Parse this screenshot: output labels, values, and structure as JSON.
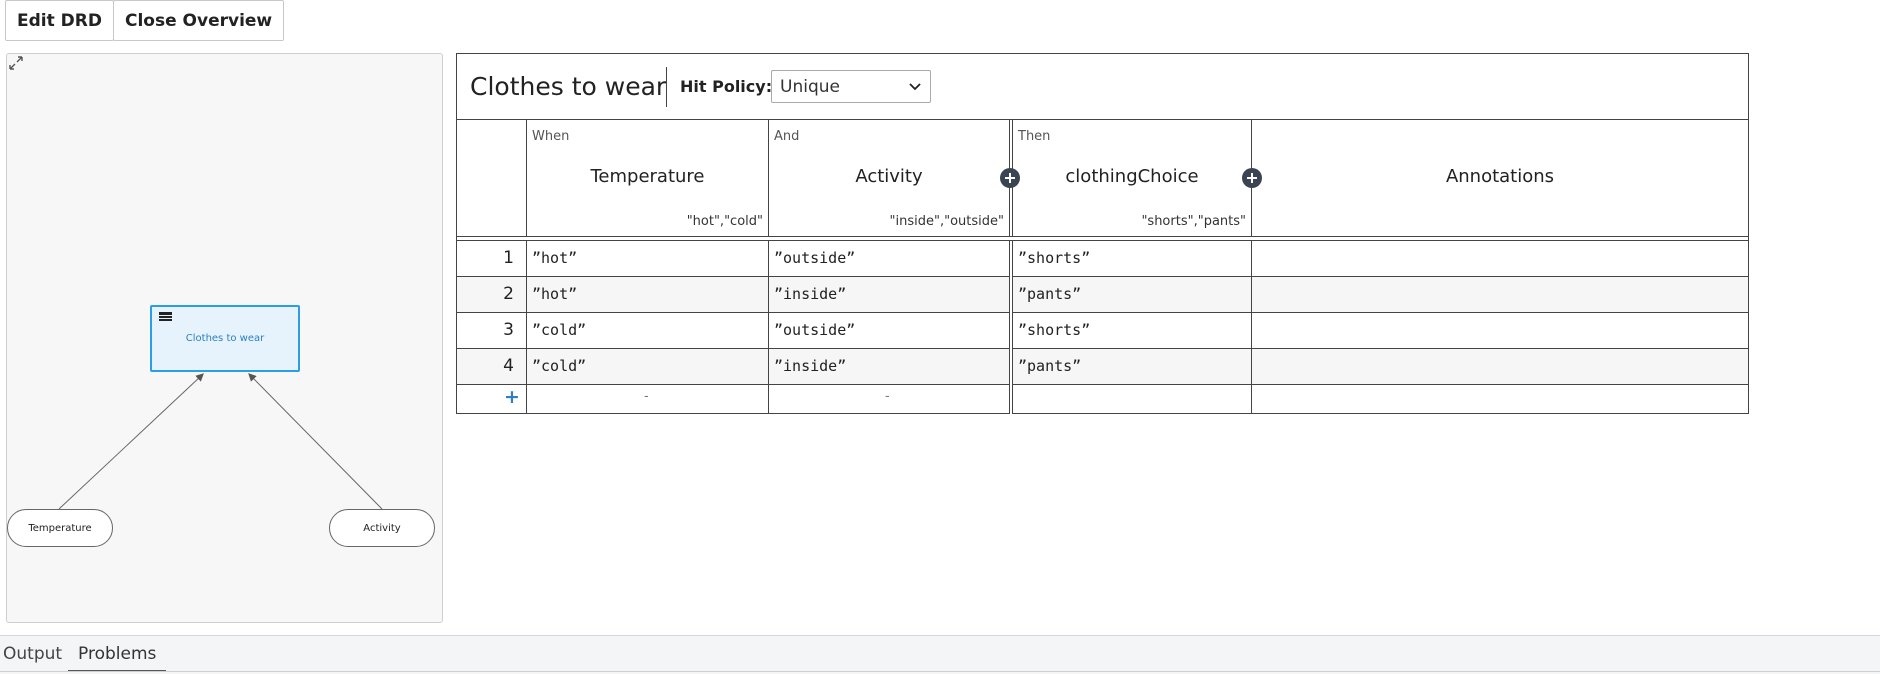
{
  "toolbar": {
    "edit_drd": "Edit DRD",
    "close_overview": "Close Overview"
  },
  "drd": {
    "decision_label": "Clothes to wear",
    "inputs": [
      {
        "label": "Temperature"
      },
      {
        "label": "Activity"
      }
    ]
  },
  "decision_table": {
    "name": "Clothes to wear",
    "hit_policy_label": "Hit Policy:",
    "hit_policy_value": "Unique",
    "columns": [
      {
        "keyword": "When",
        "title": "Temperature",
        "values": "\"hot\",\"cold\""
      },
      {
        "keyword": "And",
        "title": "Activity",
        "values": "\"inside\",\"outside\""
      },
      {
        "keyword": "Then",
        "title": "clothingChoice",
        "values": "\"shorts\",\"pants\""
      },
      {
        "keyword": "",
        "title": "Annotations",
        "values": ""
      }
    ],
    "rows": [
      {
        "index": "1",
        "temperature": "”hot”",
        "activity": "”outside”",
        "output": "”shorts”"
      },
      {
        "index": "2",
        "temperature": "”hot”",
        "activity": "”inside”",
        "output": "”pants”"
      },
      {
        "index": "3",
        "temperature": "”cold”",
        "activity": "”outside”",
        "output": "”shorts”"
      },
      {
        "index": "4",
        "temperature": "”cold”",
        "activity": "”inside”",
        "output": "”pants”"
      }
    ],
    "add_row_symbol": "+",
    "empty_input_symbol": "-"
  },
  "bottom_panel": {
    "tabs": [
      {
        "label": "Output"
      },
      {
        "label": "Problems"
      }
    ]
  },
  "icons": {
    "collapse": "collapse-arrows-icon",
    "table": "table-icon",
    "chevron": "chevron-down-icon",
    "add_column": "plus-circle-icon"
  },
  "colors": {
    "accent": "#2a9ee8",
    "decision_fill": "#e6f3fc",
    "add_button": "#3b4452"
  }
}
